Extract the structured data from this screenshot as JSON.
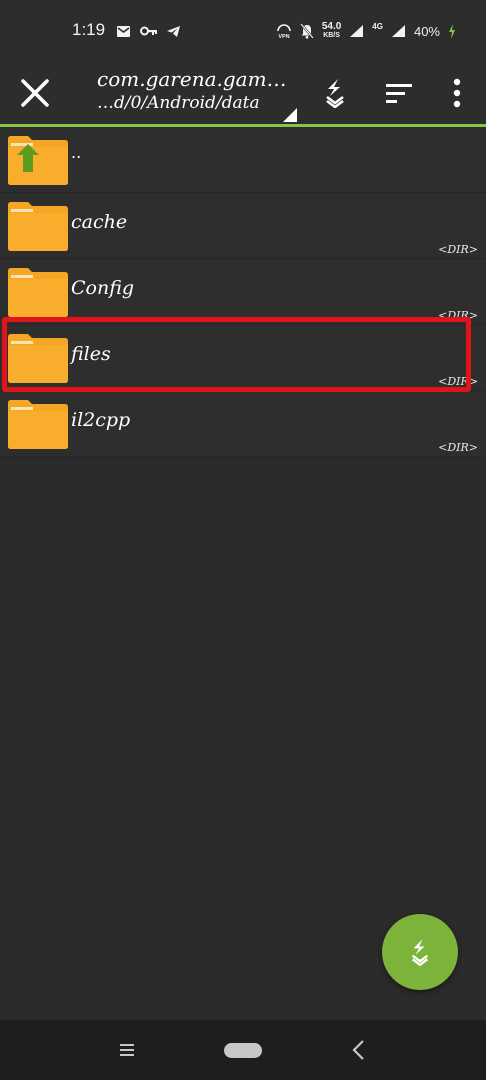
{
  "status_bar": {
    "time": "1:19",
    "net_speed_value": "54.0",
    "net_speed_unit": "KB/S",
    "network_type": "4G",
    "battery": "40%",
    "icons": [
      "mail-icon",
      "key-icon",
      "telegram-icon",
      "vpn-icon",
      "bell-off-icon",
      "signal-icon",
      "signal-icon",
      "battery-charging-icon"
    ]
  },
  "toolbar": {
    "title": "com.garena.gam…",
    "path": "…d/0/Android/data",
    "icons": [
      "close-icon",
      "lightning-icon",
      "sort-icon",
      "more-vert-icon"
    ]
  },
  "files": [
    {
      "name": "..",
      "tag": "",
      "parent": true
    },
    {
      "name": "cache",
      "tag": "<DIR>"
    },
    {
      "name": "Config",
      "tag": "<DIR>"
    },
    {
      "name": "files",
      "tag": "<DIR>"
    },
    {
      "name": "il2cpp",
      "tag": "<DIR>"
    }
  ],
  "colors": {
    "accent": "#8bc34a",
    "fab": "#7cb33a",
    "folder": "#f5a623",
    "highlight": "#e0141b",
    "background": "#2b2b2b"
  },
  "nav_bar": {
    "icons": [
      "menu-icon",
      "home-pill-icon",
      "back-icon"
    ]
  }
}
